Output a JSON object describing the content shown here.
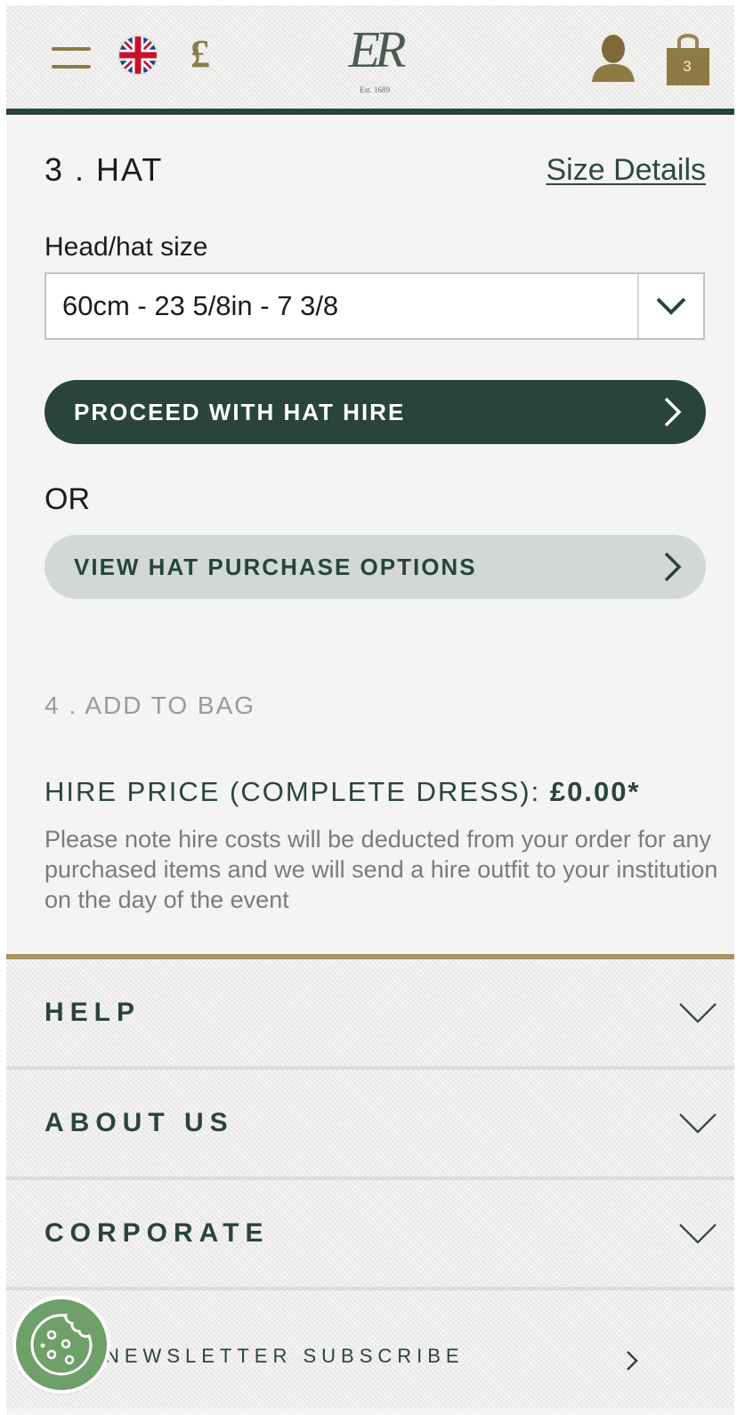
{
  "header": {
    "menu_icon": "hamburger-icon",
    "flag_icon": "uk-flag-icon",
    "currency_symbol": "£",
    "logo_text": "ER",
    "logo_est": "Est. 1689",
    "account_icon": "user-icon",
    "bag_icon": "shopping-bag-icon",
    "bag_count": "3"
  },
  "hat_section": {
    "title": "3 . HAT",
    "size_details_link": "Size Details",
    "size_label": "Head/hat size",
    "size_selected": "60cm - 23 5/8in - 7 3/8",
    "proceed_button": "PROCEED WITH HAT HIRE",
    "or_text": "OR",
    "purchase_button": "VIEW HAT PURCHASE OPTIONS"
  },
  "bag_section": {
    "title": "4 . ADD TO BAG",
    "hire_price_label": "HIRE PRICE (COMPLETE DRESS): ",
    "hire_price_value": "£0.00*",
    "note": "Please note hire costs will be deducted from your order for any purchased items and we will send a hire outfit to your institution on the day of the event"
  },
  "footer": {
    "sections": [
      {
        "label": "HELP"
      },
      {
        "label": "ABOUT US"
      },
      {
        "label": "CORPORATE"
      }
    ],
    "newsletter_label": "NEWSLETTER SUBSCRIBE",
    "cookie_icon": "cookie-icon"
  },
  "colors": {
    "brand_green": "#294539",
    "gold": "#8e7a44",
    "light_button": "#d2d9d5"
  }
}
